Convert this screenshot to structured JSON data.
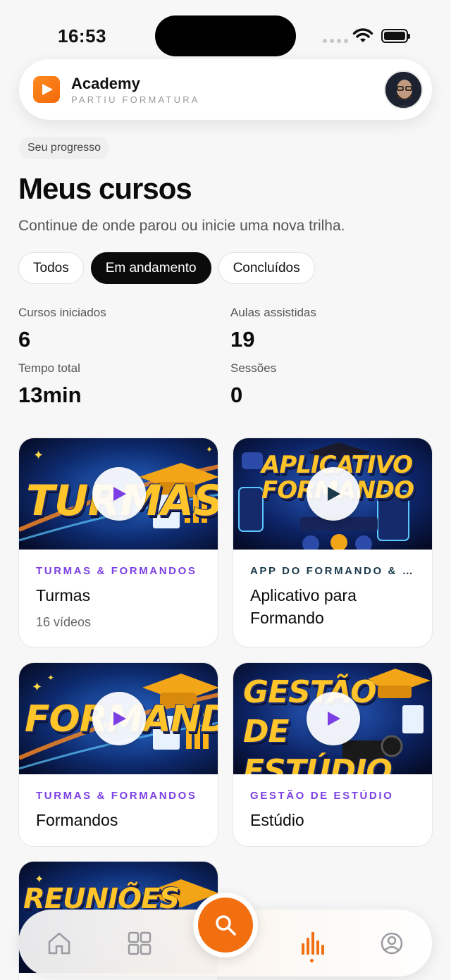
{
  "status_bar": {
    "time": "16:53"
  },
  "header": {
    "title": "Academy",
    "subtitle": "PARTIU FORMATURA"
  },
  "progress_label": "Seu progresso",
  "page": {
    "title": "Meus cursos",
    "subtitle": "Continue de onde parou ou inicie uma nova trilha."
  },
  "filters": [
    {
      "label": "Todos",
      "active": false
    },
    {
      "label": "Em andamento",
      "active": true
    },
    {
      "label": "Concluídos",
      "active": false
    }
  ],
  "stats": [
    {
      "label": "Cursos iniciados",
      "value": "6"
    },
    {
      "label": "Aulas assistidas",
      "value": "19"
    },
    {
      "label": "Tempo total",
      "value": "13min"
    },
    {
      "label": "Sessões",
      "value": "0"
    }
  ],
  "courses": [
    {
      "category": "TURMAS & FORMANDOS",
      "title": "Turmas",
      "meta": "16 vídeos",
      "thumb_word": "TURMAS"
    },
    {
      "category": "APP DO FORMANDO & ...",
      "title": "Aplicativo para Formando",
      "meta": "",
      "thumb_word": "APLICATIVO FORMANDO"
    },
    {
      "category": "TURMAS & FORMANDOS",
      "title": "Formandos",
      "meta": "",
      "thumb_word": "FORMANDOS"
    },
    {
      "category": "GESTÃO DE ESTÚDIO",
      "title": "Estúdio",
      "meta": "",
      "thumb_word": "GESTÃO DE ESTÚDIO"
    },
    {
      "category": "",
      "title": "",
      "meta": "",
      "thumb_word": "REUNIÕES"
    }
  ],
  "bottom_nav": [
    {
      "name": "home-icon",
      "active": false
    },
    {
      "name": "grid-icon",
      "active": false
    },
    {
      "name": "search-icon",
      "active": false
    },
    {
      "name": "chart-bars-icon",
      "active": true
    },
    {
      "name": "user-circle-icon",
      "active": false
    }
  ],
  "colors": {
    "accent": "#f26f10",
    "category_purple": "#7b3fe4",
    "category_dark": "#1b3a4a",
    "active_chip": "#0b0b0b"
  }
}
